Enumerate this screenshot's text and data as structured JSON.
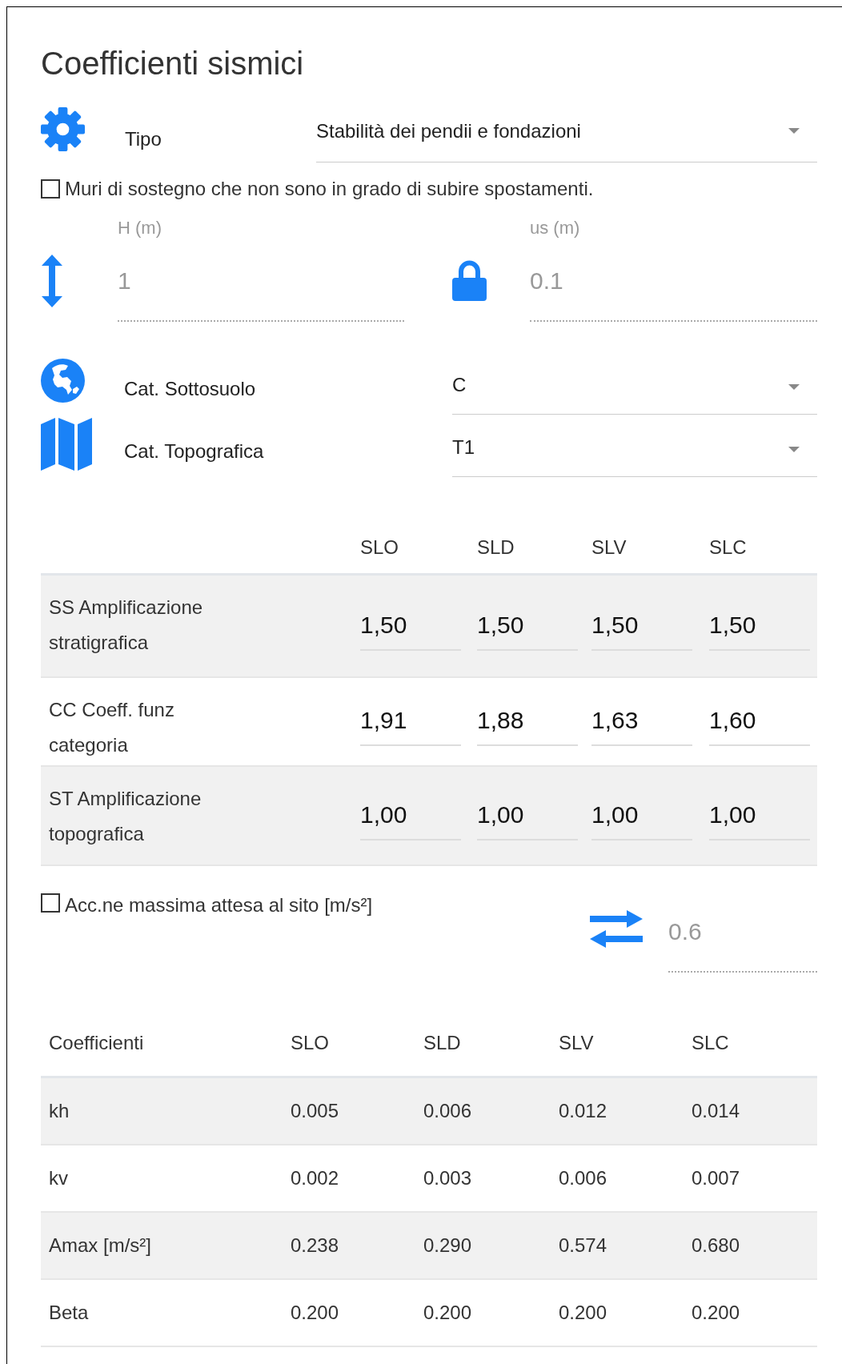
{
  "title": "Coefficienti sismici",
  "tipo": {
    "label": "Tipo",
    "value": "Stabilità dei pendii e fondazioni"
  },
  "muri": {
    "label": "Muri di sostegno che non sono in grado di subire spostamenti.",
    "checked": false
  },
  "fields": [
    {
      "kind": "height",
      "label": "H (m)",
      "value": "1",
      "disabled": true
    },
    {
      "kind": "lock",
      "label": "us (m)",
      "value": "0.1",
      "disabled": true
    }
  ],
  "categories": [
    {
      "kind": "globe",
      "label": "Cat. Sottosuolo",
      "value": "C"
    },
    {
      "kind": "map",
      "label": "Cat. Topografica",
      "value": "T1"
    }
  ],
  "amplification": {
    "columns": [
      "SLO",
      "SLD",
      "SLV",
      "SLC"
    ],
    "rows": [
      {
        "label": "SS Amplificazione stratigrafica",
        "values": [
          "1,50",
          "1,50",
          "1,50",
          "1,50"
        ]
      },
      {
        "label": "CC Coeff. funz categoria",
        "values": [
          "1,91",
          "1,88",
          "1,63",
          "1,60"
        ]
      },
      {
        "label": "ST Amplificazione topografica",
        "values": [
          "1,00",
          "1,00",
          "1,00",
          "1,00"
        ]
      }
    ]
  },
  "acc": {
    "label": "Acc.ne massima attesa al sito [m/s²]",
    "checked": false,
    "value": "0.6",
    "disabled": true
  },
  "coefficients": {
    "columns": [
      "Coefficienti",
      "SLO",
      "SLD",
      "SLV",
      "SLC"
    ],
    "rows": [
      {
        "cells": [
          "kh",
          "0.005",
          "0.006",
          "0.012",
          "0.014"
        ]
      },
      {
        "cells": [
          "kv",
          "0.002",
          "0.003",
          "0.006",
          "0.007"
        ]
      },
      {
        "cells": [
          "Amax [m/s²]",
          "0.238",
          "0.290",
          "0.574",
          "0.680"
        ]
      },
      {
        "cells": [
          "Beta",
          "0.200",
          "0.200",
          "0.200",
          "0.200"
        ]
      }
    ]
  }
}
